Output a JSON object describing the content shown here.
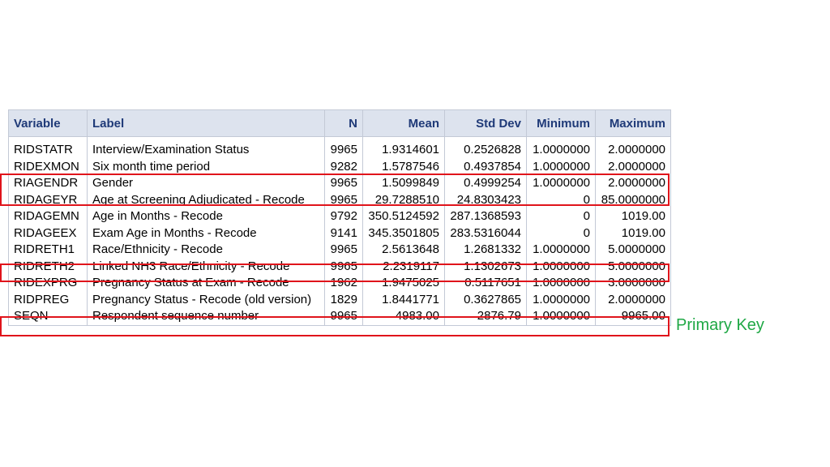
{
  "table": {
    "columns": [
      "Variable",
      "Label",
      "N",
      "Mean",
      "Std Dev",
      "Minimum",
      "Maximum"
    ],
    "rows": [
      {
        "variable": "RIDSTATR",
        "label": "Interview/Examination Status",
        "n": "9965",
        "mean": "1.9314601",
        "sd": "0.2526828",
        "min": "1.0000000",
        "max": "2.0000000"
      },
      {
        "variable": "RIDEXMON",
        "label": "Six month time period",
        "n": "9282",
        "mean": "1.5787546",
        "sd": "0.4937854",
        "min": "1.0000000",
        "max": "2.0000000"
      },
      {
        "variable": "RIAGENDR",
        "label": "Gender",
        "n": "9965",
        "mean": "1.5099849",
        "sd": "0.4999254",
        "min": "1.0000000",
        "max": "2.0000000"
      },
      {
        "variable": "RIDAGEYR",
        "label": "Age at Screening Adjudicated - Recode",
        "n": "9965",
        "mean": "29.7288510",
        "sd": "24.8303423",
        "min": "0",
        "max": "85.0000000"
      },
      {
        "variable": "RIDAGEMN",
        "label": "Age in Months - Recode",
        "n": "9792",
        "mean": "350.5124592",
        "sd": "287.1368593",
        "min": "0",
        "max": "1019.00"
      },
      {
        "variable": "RIDAGEEX",
        "label": "Exam Age in Months - Recode",
        "n": "9141",
        "mean": "345.3501805",
        "sd": "283.5316044",
        "min": "0",
        "max": "1019.00"
      },
      {
        "variable": "RIDRETH1",
        "label": "Race/Ethnicity - Recode",
        "n": "9965",
        "mean": "2.5613648",
        "sd": "1.2681332",
        "min": "1.0000000",
        "max": "5.0000000"
      },
      {
        "variable": "RIDRETH2",
        "label": "Linked NH3 Race/Ethnicity - Recode",
        "n": "9965",
        "mean": "2.2319117",
        "sd": "1.1302673",
        "min": "1.0000000",
        "max": "5.0000000"
      },
      {
        "variable": "RIDEXPRG",
        "label": "Pregnancy Status at Exam - Recode",
        "n": "1962",
        "mean": "1.9475025",
        "sd": "0.5117651",
        "min": "1.0000000",
        "max": "3.0000000"
      },
      {
        "variable": "RIDPREG",
        "label": "Pregnancy Status - Recode (old version)",
        "n": "1829",
        "mean": "1.8441771",
        "sd": "0.3627865",
        "min": "1.0000000",
        "max": "2.0000000"
      },
      {
        "variable": "SEQN",
        "label": "Respondent sequence number",
        "n": "9965",
        "mean": "4983.00",
        "sd": "2876.79",
        "min": "1.0000000",
        "max": "9965.00"
      }
    ]
  },
  "annotation": {
    "text": "Primary Key",
    "color": "#1fa845"
  },
  "highlight_color": "#e0141b",
  "highlighted_variables": [
    "RIAGENDR",
    "RIDAGEYR",
    "RIDRETH2",
    "SEQN"
  ]
}
